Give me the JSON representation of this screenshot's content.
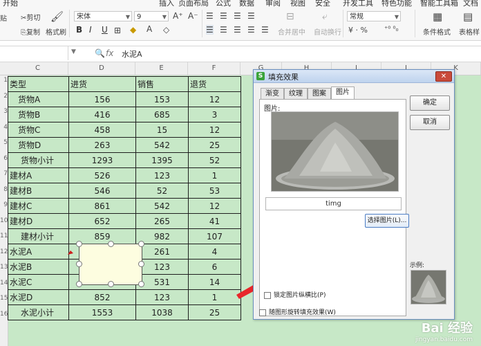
{
  "ribbon": {
    "tabs": [
      "开始",
      "插入",
      "页面布局",
      "公式",
      "数据",
      "审阅",
      "视图",
      "安全",
      "开发工具",
      "特色功能",
      "智能工具箱",
      "文档"
    ],
    "clipboard": {
      "cut": "剪切",
      "paste": "贴",
      "copy": "复制",
      "format_painter": "格式刷"
    },
    "font_name": "宋体",
    "font_size": "9",
    "format_buttons": [
      "B",
      "I",
      "U"
    ],
    "merge_center": "合并居中",
    "auto_wrap": "自动换行",
    "number_format": "常规",
    "percent_symbols": "¥ · %",
    "conditional_format": "条件格式",
    "table_style": "表格样"
  },
  "formula_bar": {
    "fx": "fx",
    "value": "水泥A"
  },
  "columns": [
    "C",
    "D",
    "E",
    "F",
    "G",
    "H",
    "I",
    "J",
    "K"
  ],
  "rows": [
    "1",
    "2",
    "3",
    "4",
    "5",
    "6",
    "7",
    "8",
    "9",
    "10",
    "11",
    "12",
    "13",
    "14",
    "15",
    "16"
  ],
  "table": {
    "headers": [
      "类型",
      "进货",
      "销售",
      "退货"
    ],
    "rows": [
      {
        "type": "货物A",
        "in": "156",
        "sold": "153",
        "ret": "12",
        "kind": "item"
      },
      {
        "type": "货物B",
        "in": "416",
        "sold": "685",
        "ret": "3",
        "kind": "item"
      },
      {
        "type": "货物C",
        "in": "458",
        "sold": "15",
        "ret": "12",
        "kind": "item"
      },
      {
        "type": "货物D",
        "in": "263",
        "sold": "542",
        "ret": "25",
        "kind": "item"
      },
      {
        "type": "货物小计",
        "in": "1293",
        "sold": "1395",
        "ret": "52",
        "kind": "sub"
      },
      {
        "type": "建材A",
        "in": "526",
        "sold": "123",
        "ret": "1",
        "kind": "item2"
      },
      {
        "type": "建材B",
        "in": "546",
        "sold": "52",
        "ret": "53",
        "kind": "item2"
      },
      {
        "type": "建材C",
        "in": "861",
        "sold": "542",
        "ret": "12",
        "kind": "item2"
      },
      {
        "type": "建材D",
        "in": "652",
        "sold": "265",
        "ret": "41",
        "kind": "item2"
      },
      {
        "type": "建材小计",
        "in": "859",
        "sold": "982",
        "ret": "107",
        "kind": "sub"
      },
      {
        "type": "水泥A",
        "in": "",
        "sold": "261",
        "ret": "4",
        "kind": "item2"
      },
      {
        "type": "水泥B",
        "in": "",
        "sold": "123",
        "ret": "6",
        "kind": "item2"
      },
      {
        "type": "水泥C",
        "in": "156",
        "sold": "531",
        "ret": "14",
        "kind": "item2"
      },
      {
        "type": "水泥D",
        "in": "852",
        "sold": "123",
        "ret": "1",
        "kind": "item2"
      },
      {
        "type": "水泥小计",
        "in": "1553",
        "sold": "1038",
        "ret": "25",
        "kind": "sub"
      }
    ]
  },
  "dialog": {
    "title": "填充效果",
    "logo": "S",
    "close": "✕",
    "tabs": [
      "渐变",
      "纹理",
      "图案",
      "图片"
    ],
    "active_tab": "图片",
    "picture_label": "图片:",
    "picture_name": "timg",
    "select_picture": "选择图片(L)...",
    "lock_aspect": "锁定图片纵横比(P)",
    "rotate_with_shape": "随图形旋转填充效果(W)",
    "ok": "确定",
    "cancel": "取消",
    "sample_label": "示例:"
  },
  "watermark": {
    "line1": "Bai 经验",
    "line2": "jingyan.baidu.com"
  },
  "colors": {
    "sheet_bg": "#c7e8c7",
    "arrow": "#e8262a",
    "shape_fill": "#fdfde0",
    "dialog_border": "#6b8fbf"
  }
}
